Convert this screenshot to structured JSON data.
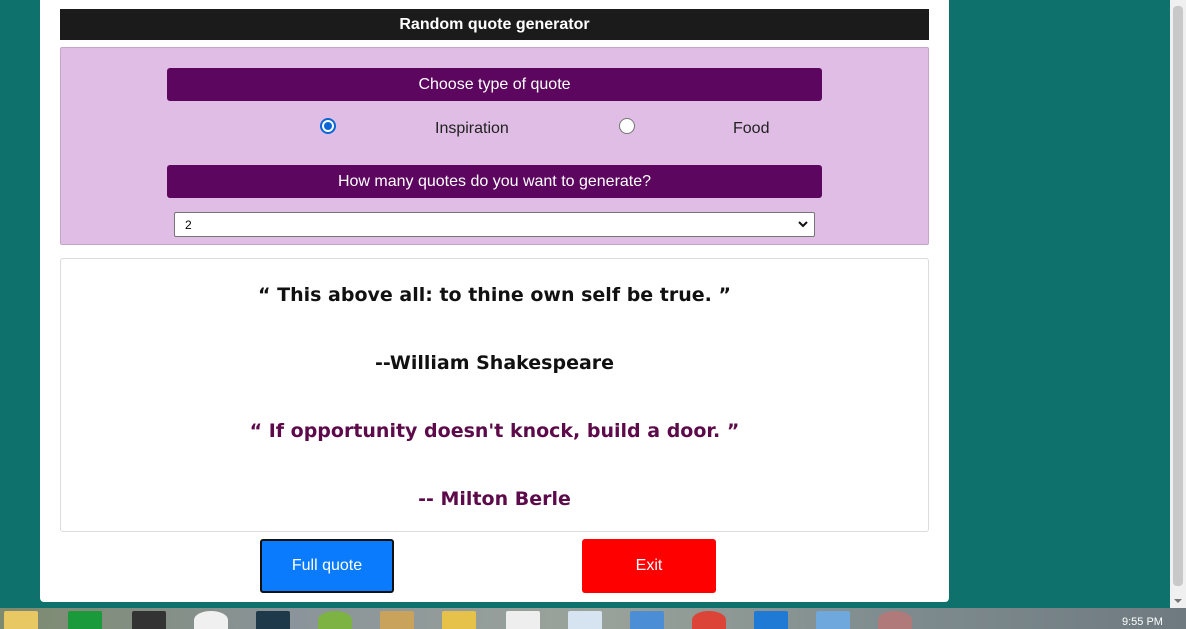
{
  "app": {
    "title": "Random quote generator"
  },
  "options": {
    "type_heading": "Choose type of quote",
    "types": [
      {
        "label": "Inspiration",
        "checked": true
      },
      {
        "label": "Food",
        "checked": false
      }
    ],
    "count_heading": "How many quotes do you want to generate?",
    "count_selected": "2"
  },
  "quotes": [
    {
      "text": "“ This above all: to thine own self be true. ”",
      "author": "--William Shakespeare"
    },
    {
      "text": "“ If opportunity doesn't knock, build a door. ”",
      "author": "-- Milton Berle"
    }
  ],
  "buttons": {
    "full_quote": "Full quote",
    "exit": "Exit"
  },
  "taskbar": {
    "time": "9:55 PM",
    "icons": [
      "file-explorer-icon",
      "store-icon",
      "app-icon",
      "hp-icon",
      "app-icon-2",
      "app-icon-3",
      "pencil-icon",
      "database-icon",
      "document-icon",
      "window-icon",
      "app-icon-4",
      "chrome-icon",
      "vscode-icon",
      "image-icon",
      "app-icon-5"
    ]
  },
  "colors": {
    "background": "#0f716b",
    "header": "#1b1b1b",
    "options_panel": "#dfbde4",
    "bar": "#5c0660",
    "quote_accent": "#5c0a4a",
    "full_quote_button": "#0a7bfd",
    "exit_button": "#ff0000"
  }
}
